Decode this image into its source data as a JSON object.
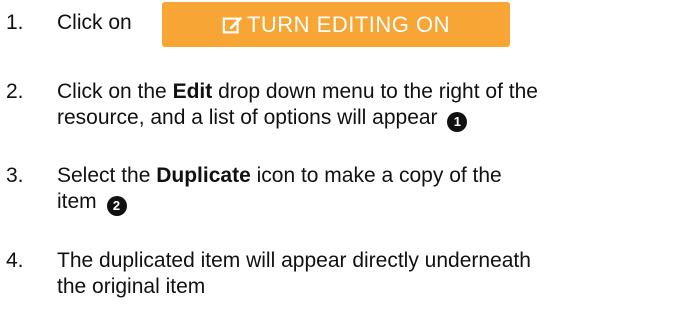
{
  "steps": [
    {
      "number": "1.",
      "text": "Click on",
      "button_label": "TURN EDITING ON",
      "button_icon": "pencil-square-icon",
      "button_color": "#f7a535"
    },
    {
      "number": "2.",
      "before": "Click on the ",
      "bold": "Edit",
      "line1_after": " drop down menu to the right of the",
      "line2": "resource, and a list of options will appear",
      "badge": "1"
    },
    {
      "number": "3.",
      "before": "Select the ",
      "bold": "Duplicate",
      "line1_after": " icon to make a copy of the",
      "line2": "item",
      "badge": "2"
    },
    {
      "number": "4.",
      "line1": "The duplicated item will appear directly underneath",
      "line2": "the original item"
    }
  ]
}
